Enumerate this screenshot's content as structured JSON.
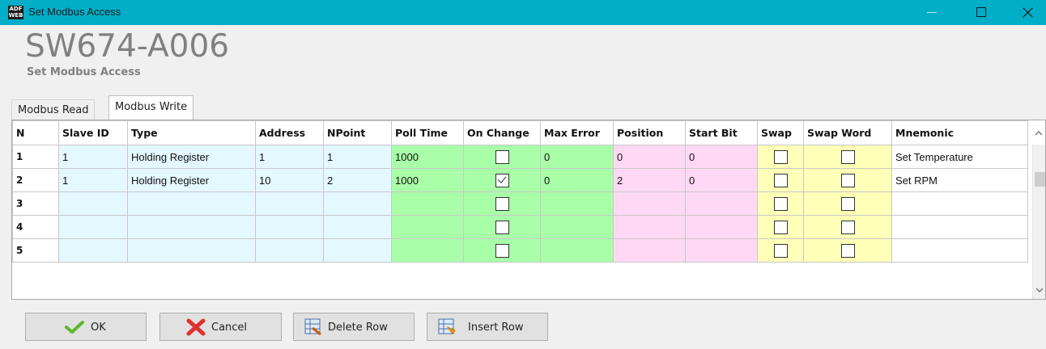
{
  "window": {
    "title": "Set Modbus Access",
    "icon_text_top": "ADF",
    "icon_text_bottom": "WEB"
  },
  "header": {
    "title": "SW674-A006",
    "subtitle": "Set Modbus Access"
  },
  "tabs": [
    {
      "label": "Modbus Read",
      "active": false
    },
    {
      "label": "Modbus Write",
      "active": true
    }
  ],
  "grid": {
    "columns": [
      "N",
      "Slave ID",
      "Type",
      "Address",
      "NPoint",
      "Poll Time",
      "On Change",
      "Max Error",
      "Position",
      "Start Bit",
      "Swap",
      "Swap Word",
      "Mnemonic"
    ],
    "rows": [
      {
        "n": "1",
        "slave_id": "1",
        "type": "Holding Register",
        "address": "1",
        "npoint": "1",
        "poll_time": "1000",
        "on_change": false,
        "max_error": "0",
        "position": "0",
        "start_bit": "0",
        "swap": false,
        "swap_word": false,
        "mnemonic": "Set Temperature"
      },
      {
        "n": "2",
        "slave_id": "1",
        "type": "Holding Register",
        "address": "10",
        "npoint": "2",
        "poll_time": "1000",
        "on_change": true,
        "max_error": "0",
        "position": "2",
        "start_bit": "0",
        "swap": false,
        "swap_word": false,
        "mnemonic": "Set RPM"
      },
      {
        "n": "3",
        "slave_id": "",
        "type": "",
        "address": "",
        "npoint": "",
        "poll_time": "",
        "on_change": false,
        "max_error": "",
        "position": "",
        "start_bit": "",
        "swap": false,
        "swap_word": false,
        "mnemonic": ""
      },
      {
        "n": "4",
        "slave_id": "",
        "type": "",
        "address": "",
        "npoint": "",
        "poll_time": "",
        "on_change": false,
        "max_error": "",
        "position": "",
        "start_bit": "",
        "swap": false,
        "swap_word": false,
        "mnemonic": ""
      },
      {
        "n": "5",
        "slave_id": "",
        "type": "",
        "address": "",
        "npoint": "",
        "poll_time": "",
        "on_change": false,
        "max_error": "",
        "position": "",
        "start_bit": "",
        "swap": false,
        "swap_word": false,
        "mnemonic": ""
      }
    ]
  },
  "buttons": {
    "ok": "OK",
    "cancel": "Cancel",
    "delete_row": "Delete Row",
    "insert_row": "Insert Row"
  },
  "colors": {
    "titlebar": "#00aec8",
    "cyan_cell": "#e4f8ff",
    "green_cell": "#a8ffa8",
    "pink_cell": "#ffd9f4",
    "yellow_cell": "#ffffb8"
  }
}
